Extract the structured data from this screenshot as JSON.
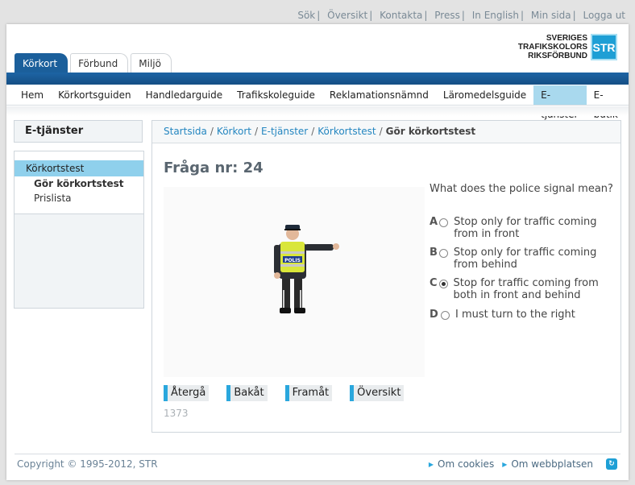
{
  "top_links": [
    "Sök",
    "Översikt",
    "Kontakta",
    "Press",
    "In English",
    "Min sida",
    "Logga ut"
  ],
  "logo": {
    "line1": "SVERIGES",
    "line2": "TRAFIKSKOLORS",
    "line3": "RIKSFÖRBUND",
    "mark": "STR"
  },
  "tabs": [
    "Körkort",
    "Förbund",
    "Miljö"
  ],
  "main_nav": [
    "Hem",
    "Körkortsguiden",
    "Handledarguide",
    "Trafikskoleguide",
    "Reklamationsnämnd",
    "Läromedelsguide",
    "E-tjänster",
    "E-butik"
  ],
  "sidebar": {
    "heading": "E-tjänster",
    "item": "Körkortstest",
    "sub_active": "Gör körkortstest",
    "sub_other": "Prislista"
  },
  "breadcrumb": [
    "Startsida",
    "Körkort",
    "E-tjänster",
    "Körkortstest"
  ],
  "breadcrumb_current": "Gör körkortstest",
  "question_title": "Fråga nr: 24",
  "question_text": "What does the police signal mean?",
  "police_vest_text": "POLIS",
  "options": [
    {
      "letter": "A",
      "text": "Stop only for traffic coming from in front",
      "selected": false
    },
    {
      "letter": "B",
      "text": "Stop only for traffic coming from behind",
      "selected": false
    },
    {
      "letter": "C",
      "text": "Stop for traffic coming from both in front and behind",
      "selected": true
    },
    {
      "letter": "D",
      "text": "I must turn to the right",
      "selected": false
    }
  ],
  "buttons": [
    "Återgå",
    "Bakåt",
    "Framåt",
    "Översikt"
  ],
  "question_code": "1373",
  "footer": {
    "copyright": "Copyright © 1995-2012, STR",
    "links": [
      "Om cookies",
      "Om webbplatsen"
    ]
  },
  "colors": {
    "brand_blue": "#1b5f9b",
    "accent": "#2aa7dd",
    "nav_active": "#a9d9ee"
  }
}
